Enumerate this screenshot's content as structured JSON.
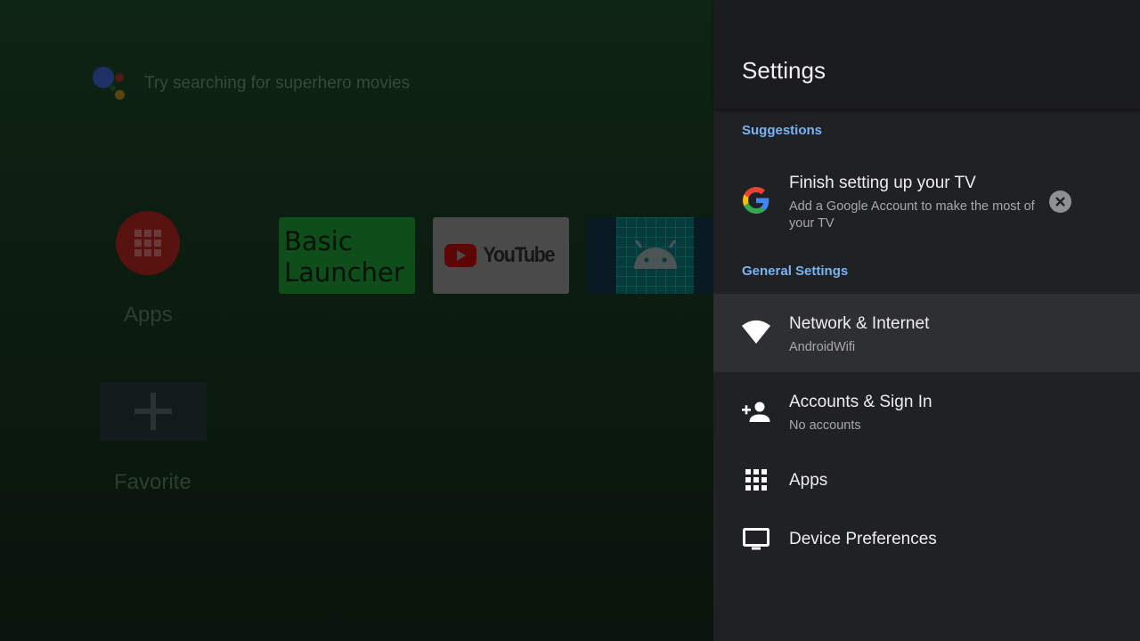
{
  "launcher": {
    "search_hint": "Try searching for superhero movies",
    "apps_label": "Apps",
    "favorite_label": "Favorite",
    "tiles": {
      "basic_launcher": "Basic\nLauncher",
      "youtube": "YouTube"
    }
  },
  "settings": {
    "title": "Settings",
    "sections": {
      "suggestions": "Suggestions",
      "general": "General Settings"
    },
    "suggestion": {
      "title": "Finish setting up your TV",
      "subtitle": "Add a Google Account to make the most of your TV",
      "icon": "google-g-icon",
      "dismiss_icon": "close-circle-icon"
    },
    "items": [
      {
        "title": "Network & Internet",
        "subtitle": "AndroidWifi",
        "icon": "wifi-icon",
        "focused": true
      },
      {
        "title": "Accounts & Sign In",
        "subtitle": "No accounts",
        "icon": "add-person-icon"
      },
      {
        "title": "Apps",
        "icon": "apps-grid-icon"
      },
      {
        "title": "Device Preferences",
        "icon": "tv-icon"
      }
    ]
  },
  "colors": {
    "panel_bg": "#202124",
    "header_bg": "#1b1c1f",
    "section_label": "#7ab3f0",
    "focused_row": "#2e2f33"
  }
}
